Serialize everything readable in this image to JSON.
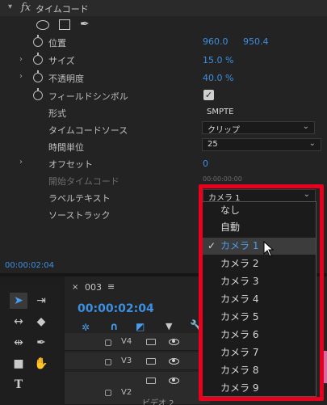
{
  "effect_controls": {
    "fx_label": "fx",
    "effect_name": "タイムコード",
    "rows": {
      "position": {
        "label": "位置",
        "x": "960.0",
        "y": "950.4"
      },
      "size": {
        "label": "サイズ",
        "value": "15.0 %"
      },
      "opacity": {
        "label": "不透明度",
        "value": "40.0 %"
      },
      "field_symbol": {
        "label": "フィールドシンボル",
        "checked": true
      },
      "format": {
        "label": "形式",
        "value": "SMPTE"
      },
      "timecode_source": {
        "label": "タイムコードソース",
        "value": "クリップ"
      },
      "time_unit": {
        "label": "時間単位",
        "value": "25"
      },
      "offset": {
        "label": "オフセット",
        "value": "0"
      },
      "start_timecode": {
        "label": "開始タイムコード",
        "value": "00:00:00:00"
      },
      "label_text": {
        "label": "ラベルテキスト",
        "value": "カメラ 1"
      },
      "source_track": {
        "label": "ソーストラック"
      }
    },
    "current_time": "00:00:02:04"
  },
  "timeline": {
    "tab_name": "003",
    "timecode": "00:00:02:04",
    "tracks": [
      {
        "name": "V4"
      },
      {
        "name": "V3"
      },
      {
        "name": "V2"
      }
    ],
    "video_label": "ビデオ 2"
  },
  "dropdown": {
    "options": [
      "なし",
      "自動",
      "カメラ 1",
      "カメラ 2",
      "カメラ 3",
      "カメラ 4",
      "カメラ 5",
      "カメラ 6",
      "カメラ 7",
      "カメラ 8",
      "カメラ 9"
    ],
    "selected_index": 2,
    "check_glyph": "✓"
  },
  "colors": {
    "accent_blue": "#3d8fe0",
    "highlight_frame": "#e8001c"
  }
}
